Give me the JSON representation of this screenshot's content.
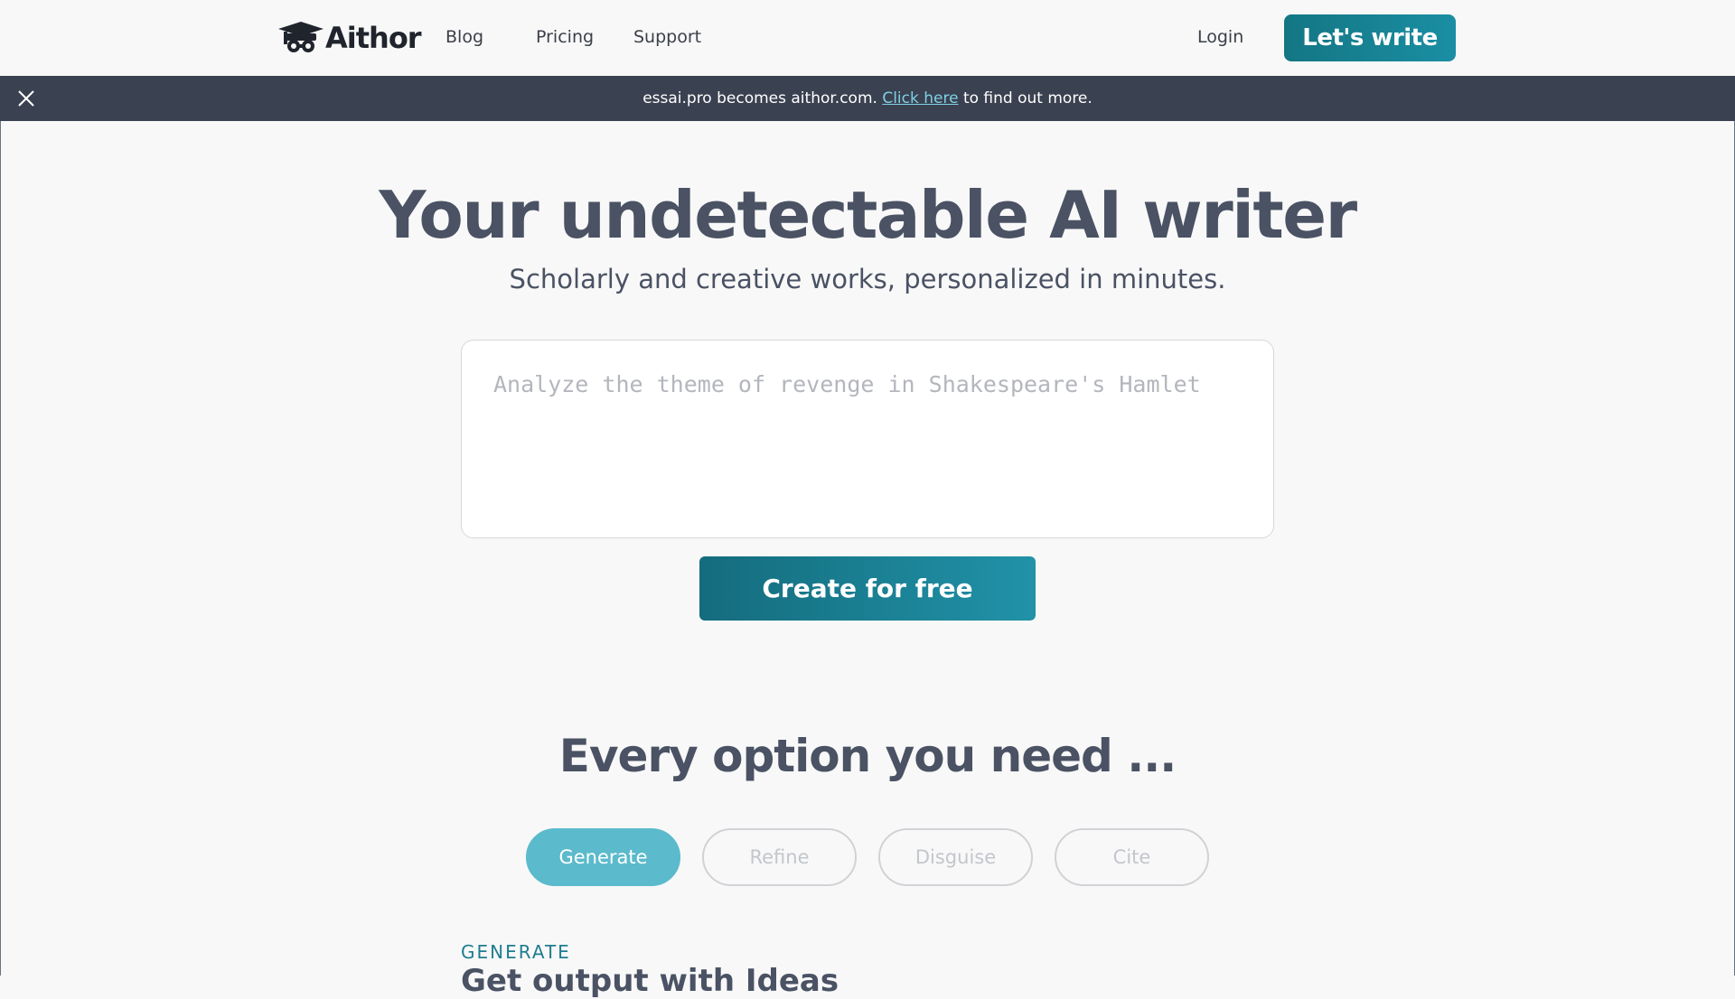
{
  "nav": {
    "logo_text": "Aithor",
    "links": [
      "Blog",
      "Pricing",
      "Support"
    ],
    "login": "Login",
    "cta": "Let's write"
  },
  "banner": {
    "text_before": "essai.pro becomes aithor.com. ",
    "link_text": "Click here",
    "text_after": " to find out more."
  },
  "hero": {
    "title": "Your undetectable AI writer",
    "subtitle": "Scholarly and creative works, personalized in minutes.",
    "prompt_placeholder": "Analyze the theme of revenge in Shakespeare's Hamlet",
    "prompt_value": "",
    "cta": "Create for free"
  },
  "options": {
    "title": "Every option you need ...",
    "tabs": [
      {
        "label": "Generate",
        "active": true
      },
      {
        "label": "Refine",
        "active": false
      },
      {
        "label": "Disguise",
        "active": false
      },
      {
        "label": "Cite",
        "active": false
      }
    ],
    "eyebrow": "GENERATE",
    "heading": "Get output with Ideas"
  },
  "colors": {
    "accent": "#1b8ea3",
    "banner_bg": "#3a4150",
    "link": "#7fd0e6",
    "active_pill": "#5bbacc",
    "text": "#4a5264"
  },
  "icons": {
    "logo": "graduation-cap-mask-icon",
    "banner_close": "close-icon"
  }
}
